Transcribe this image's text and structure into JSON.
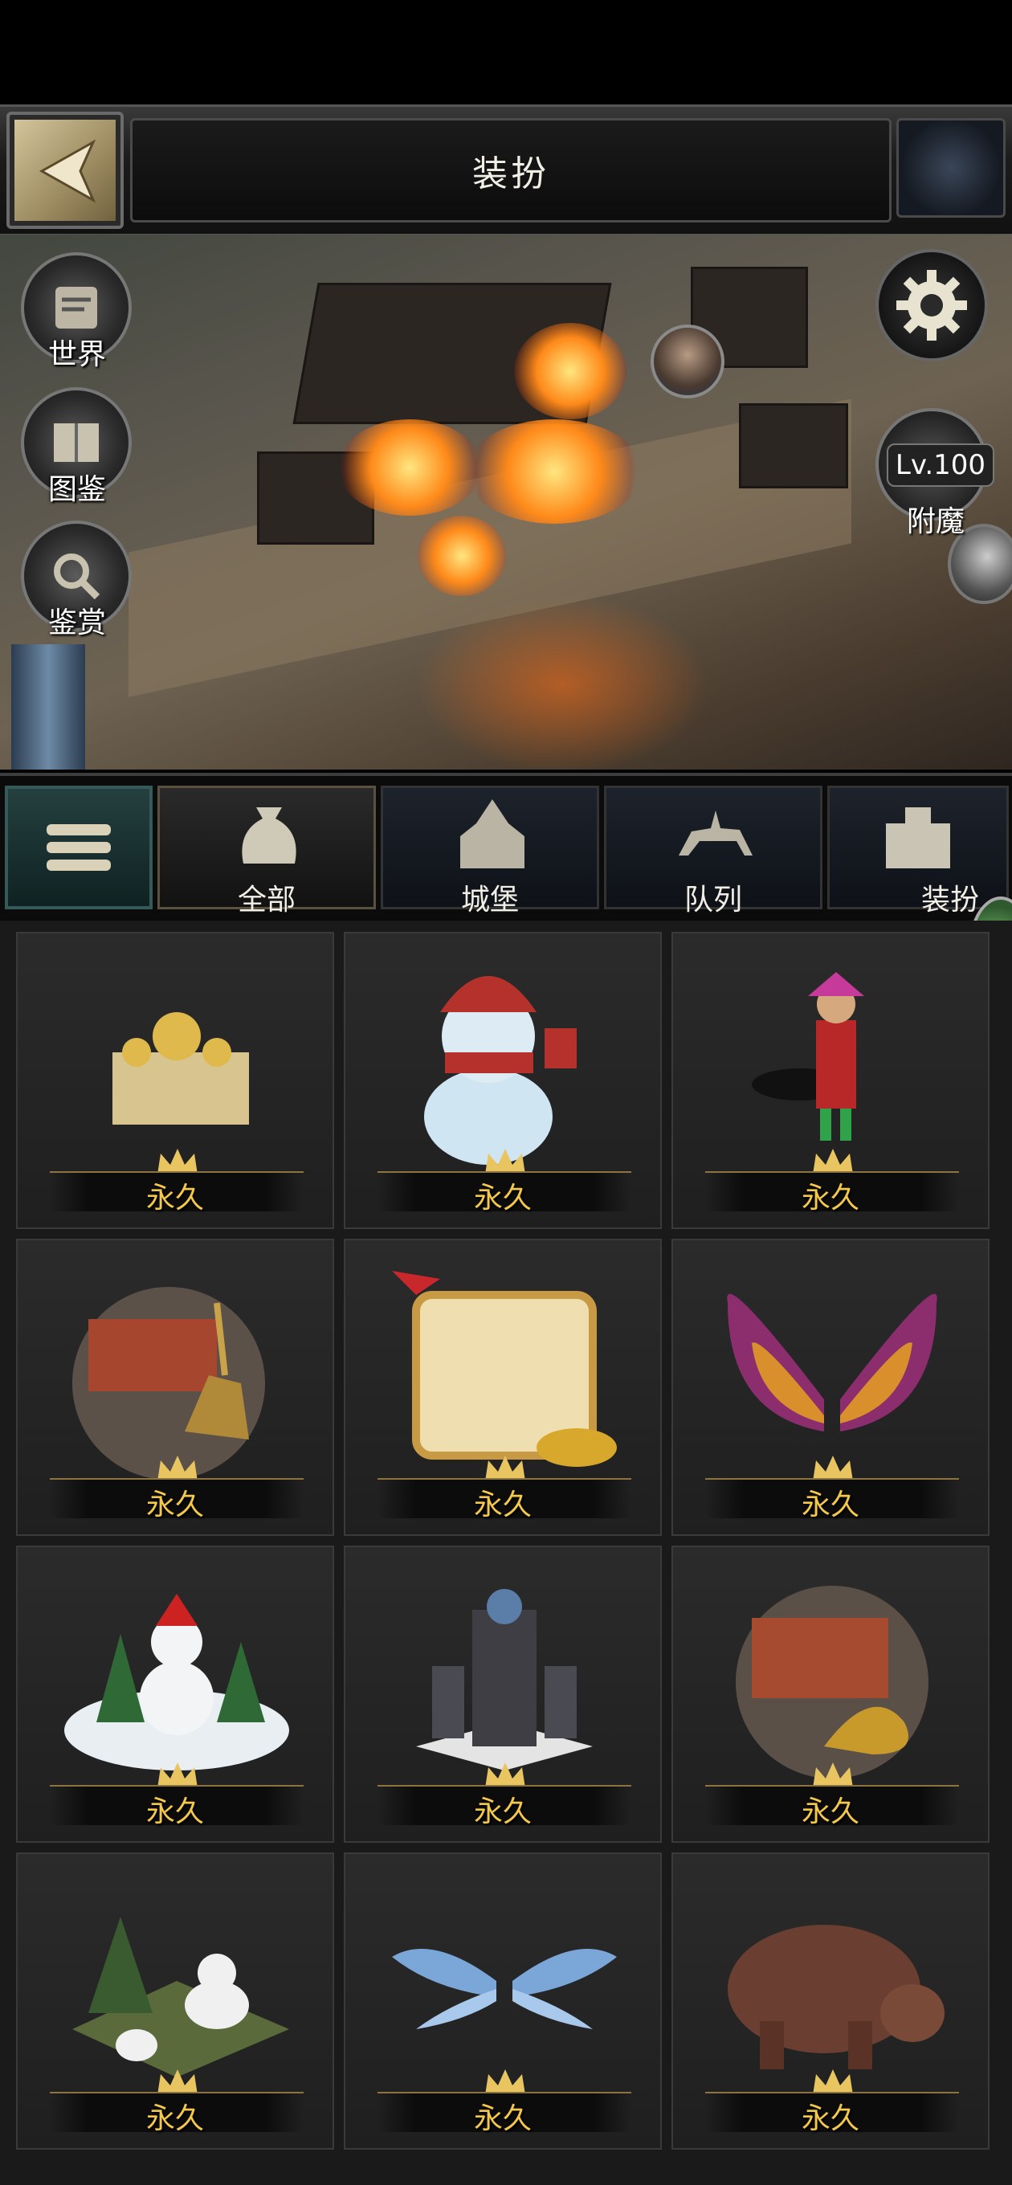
{
  "header": {
    "title": "装扮",
    "back_icon": "chevron-left-icon"
  },
  "left_menu": [
    {
      "label": "世界",
      "icon": "scroll-map-icon"
    },
    {
      "label": "图鉴",
      "icon": "scroll-book-icon"
    },
    {
      "label": "鉴赏",
      "icon": "appraise-icon"
    }
  ],
  "right_menu": {
    "settings_icon": "gear-icon",
    "enchant": {
      "level": "Lv.100",
      "label": "附魔",
      "icon": "blade-icon"
    }
  },
  "tabs": [
    {
      "label": "全部",
      "icon": "bag-icon",
      "active": true
    },
    {
      "label": "城堡",
      "icon": "castle-icon",
      "active": false
    },
    {
      "label": "队列",
      "icon": "cavalry-icon",
      "active": false
    },
    {
      "label": "装扮",
      "icon": "building-icon",
      "active": false
    }
  ],
  "items": [
    {
      "name": "moon-palace",
      "duration": "永久"
    },
    {
      "name": "snowman",
      "duration": "永久"
    },
    {
      "name": "jester",
      "duration": "永久"
    },
    {
      "name": "centaur-archer-castle",
      "duration": "永久"
    },
    {
      "name": "gift-card-frame",
      "duration": "永久"
    },
    {
      "name": "butterfly-wings",
      "duration": "永久"
    },
    {
      "name": "christmas-snowman-scene",
      "duration": "永久"
    },
    {
      "name": "white-fortress",
      "duration": "永久"
    },
    {
      "name": "scorpion-castle",
      "duration": "永久"
    },
    {
      "name": "panda-garden",
      "duration": "永久"
    },
    {
      "name": "ice-wings",
      "duration": "永久"
    },
    {
      "name": "brown-bear",
      "duration": "永久"
    }
  ],
  "colors": {
    "accent_gold": "#f4c84a",
    "active_tab": "#5b5140"
  }
}
